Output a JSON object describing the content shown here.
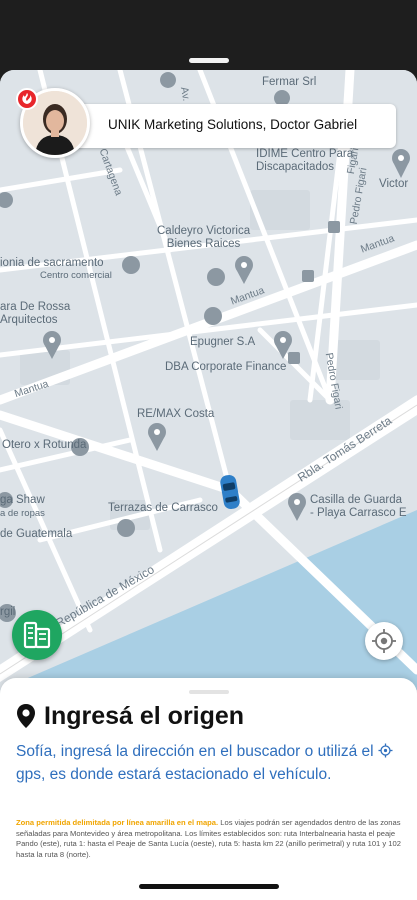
{
  "header": {
    "company_name": "UNIK Marketing Solutions, Doctor Gabriel"
  },
  "map": {
    "labels": {
      "fermar": "Fermar Srl",
      "dime": "IDIME Centro Para\nDiscapacitados",
      "victor": "Victor",
      "caldeyro": "Caldeyro Victorica\nBienes Raices",
      "sacramento": "ionia de sacramento",
      "centro_comercial": "Centro comercial",
      "rossa": "ara De Rossa\nArquitectos",
      "epugner": "Epugner S.A",
      "dba": "DBA Corporate Finance",
      "remax": "RE/MAX Costa",
      "rotunda": "Otero x Rotunda",
      "shaw": "ga Shaw",
      "tienda_ropa": "a de ropas",
      "guatemala": "de Guatemala",
      "terrazas": "Terrazas de Carrasco",
      "casilla": "Casilla de Guarda\n- Playa Carrasco E",
      "rgil": "rgil"
    },
    "streets": {
      "mantua_1": "Mantua",
      "mantua_2": "Mantua",
      "mantua_3": "Mantua",
      "pedro_figari_1": "Pedro Figari",
      "pedro_figari_2": "Pedro Figari",
      "figari_top": "Figari",
      "cartagena": "Cartagena",
      "rambla_tomas": "Rbla. Tomás Berreta",
      "rambla_mexico": "Rbla. República de México",
      "avenida": "Av."
    },
    "colors": {
      "road": "#ffffff",
      "land": "#dde3e8",
      "water": "#a9cfe4",
      "pin": "#8c98a2",
      "car": "#2e7fc8"
    }
  },
  "origin": {
    "title": "Ingresá el origen",
    "line1": "Sofía, ingresá la dirección en el buscador o utilizá el",
    "line2": "gps, es donde estará estacionado el vehículo.",
    "notice_highlight": "Zona permitida delimitada por línea amarilla en el mapa.",
    "notice_text": " Los viajes podrán ser agendados dentro de las zonas señaladas para Montevideo y área metropolitana. Los límites establecidos son: ruta Interbalnearia hasta el peaje Pando (este), ruta 1: hasta el Peaje de Santa Lucía (oeste), ruta 5: hasta km 22 (anillo perimetral) y ruta 101 y 102 hasta la ruta 8 (norte)."
  },
  "icons": {
    "badge": "santander-logo-icon",
    "location": "location-pin-icon",
    "gps": "gps-target-icon",
    "buildings": "buildings-icon",
    "crosshair": "my-location-icon"
  }
}
